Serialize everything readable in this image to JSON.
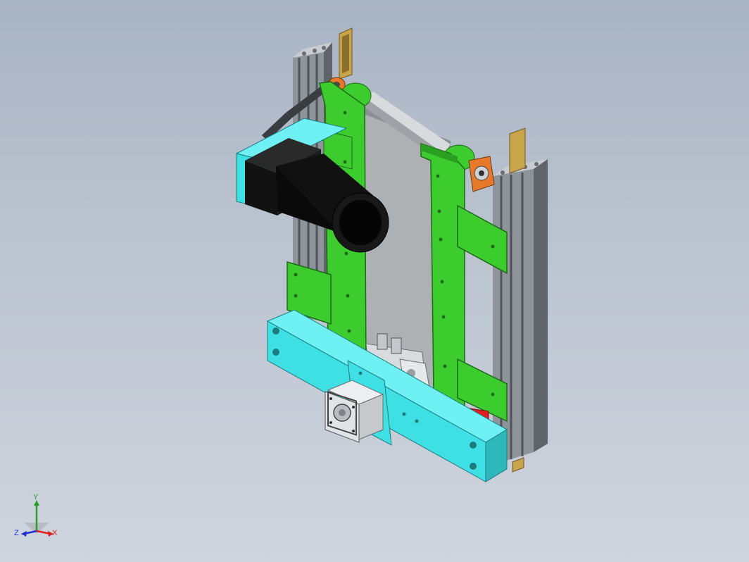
{
  "viewport": {
    "background_top": "#a9b4c3",
    "background_bottom": "#cfd5de"
  },
  "colors": {
    "plate_green": "#3dcc2e",
    "base_cyan": "#3fe0e3",
    "profile_gray": "#8e949a",
    "motor_black": "#121212",
    "roller_silver": "#b8bcc0",
    "bearing_orange": "#e8782a",
    "brass_strip": "#c9a54a",
    "stop_red": "#e02020"
  },
  "triad": {
    "x_label": "X",
    "y_label": "Y",
    "z_label": "Z",
    "x_color": "#e02020",
    "y_color": "#28a028",
    "z_color": "#2030d0"
  }
}
